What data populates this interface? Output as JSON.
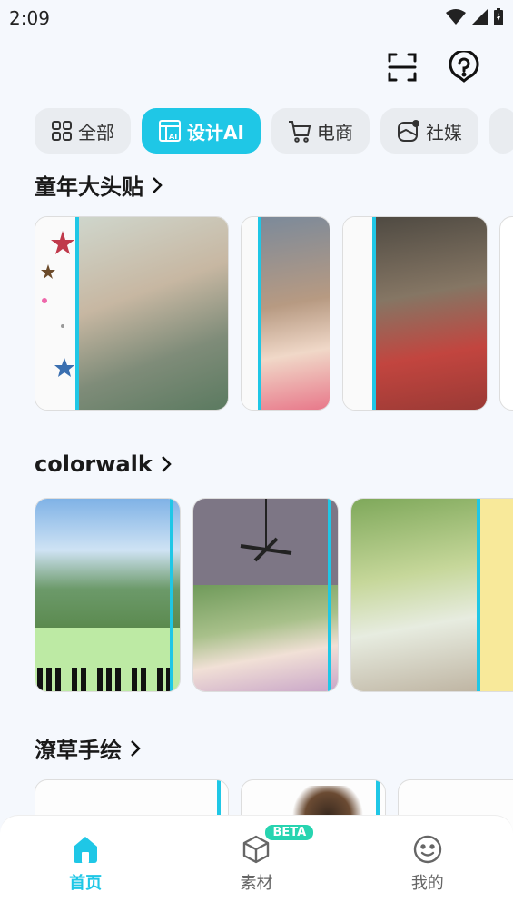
{
  "status": {
    "time": "2:09"
  },
  "tabs": [
    {
      "label": "全部",
      "icon": "grid-icon"
    },
    {
      "label": "设计AI",
      "icon": "ai-layout-icon"
    },
    {
      "label": "电商",
      "icon": "cart-icon"
    },
    {
      "label": "社媒",
      "icon": "social-icon"
    }
  ],
  "sections": [
    {
      "title": "童年大头贴"
    },
    {
      "title": "colorwalk"
    },
    {
      "title": "潦草手绘"
    }
  ],
  "nav": [
    {
      "label": "首页",
      "icon": "home-icon"
    },
    {
      "label": "素材",
      "icon": "cube-icon",
      "badge": "BETA"
    },
    {
      "label": "我的",
      "icon": "smile-icon"
    }
  ],
  "colors": {
    "accent": "#1fc7e6",
    "badge": "#27d4b0"
  }
}
